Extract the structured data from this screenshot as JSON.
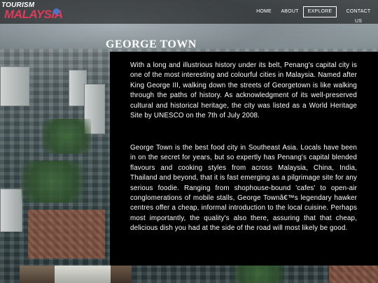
{
  "brand": {
    "logo_top": "TOURISM",
    "logo_main": "MALAYSIA"
  },
  "nav": {
    "items": [
      {
        "label": "HOME",
        "active": false
      },
      {
        "label": "ABOUT",
        "active": false
      },
      {
        "label": "EXPLORE",
        "active": true
      },
      {
        "label": "CONTACT US",
        "active": false
      }
    ]
  },
  "page": {
    "title": "GEORGE TOWN",
    "paragraphs": [
      "With a long and illustrious history under its belt, Penang's capital city is one of the most interesting and colourful cities in Malaysia. Named after King George III, walking down the streets of Georgetown is like walking through the paths of history. As acknowledgment of its well-preserved cultural and historical heritage, the city was listed as a World Heritage Site by UNESCO on the 7th of July 2008.",
      "George Town is the best food city in Southeast Asia. Locals have been in on the secret for years, but so expertly has Penang's capital blended flavours and cooking styles from across Malaysia, China, India, Thailand and beyond, that it is fast emerging as a pilgrimage site for any serious foodie. Ranging from shophouse-bound 'cafes' to open-air conglomerations of mobile stalls, George Townâ€™s legendary hawker centres offer a cheap, informal introduction to the local cuisine. Perhaps most importantly, the quality's also there, assuring that that cheap, delicious dish you had at the side of the road will most likely be good."
    ]
  },
  "colors": {
    "logo_accent": "#e03a5c",
    "panel_bg": "#000000",
    "text": "#ffffff"
  }
}
